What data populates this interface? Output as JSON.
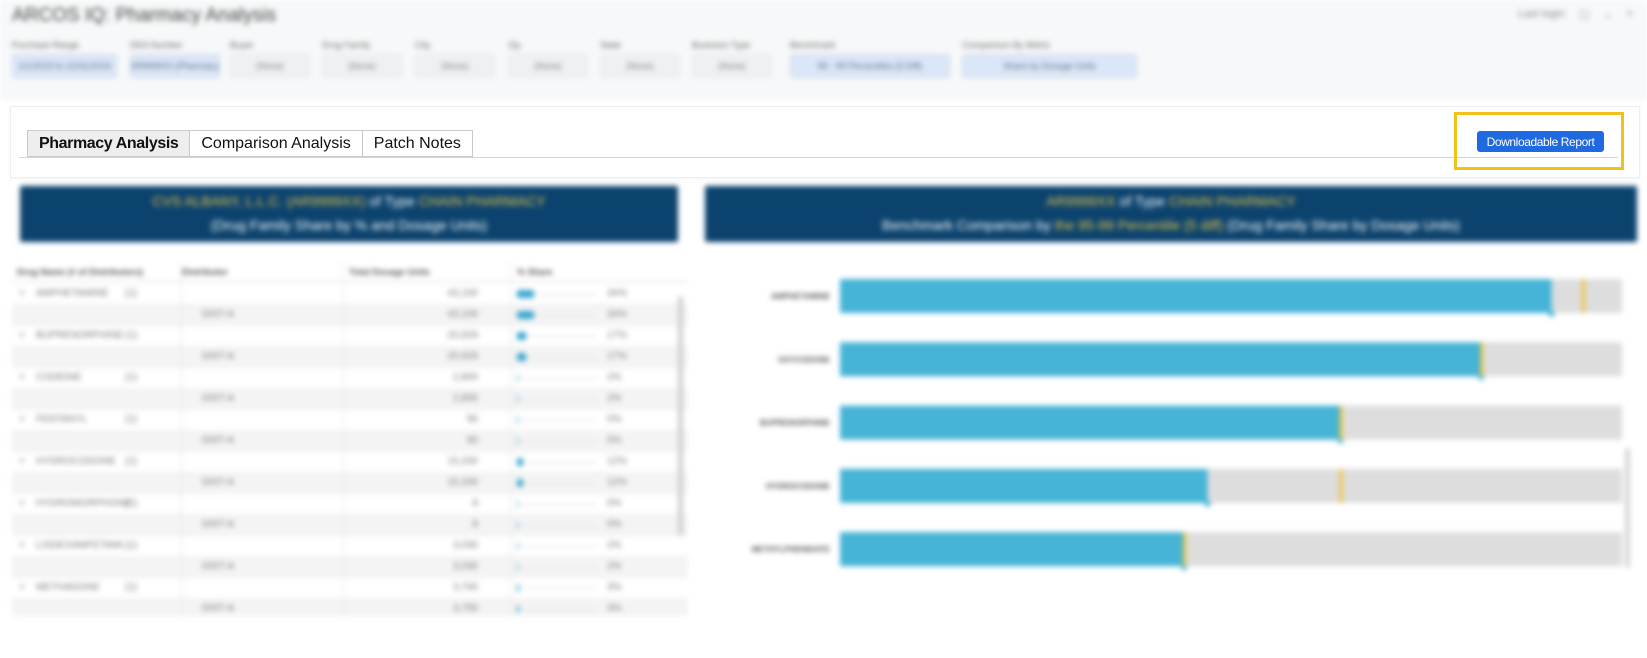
{
  "header": {
    "app_title": "ARCOS IQ: Pharmacy Analysis",
    "right_text": "Last login"
  },
  "filters": [
    {
      "label": "Purchase Range",
      "value": "1/1/2019 to 12/31/2019",
      "selected": true
    },
    {
      "label": "DEA Number",
      "value": "AR9999XX (Pharmacy)",
      "selected": true
    },
    {
      "label": "Buyer",
      "value": "(None)",
      "selected": false
    },
    {
      "label": "Drug Family",
      "value": "(None)",
      "selected": false
    },
    {
      "label": "City",
      "value": "(None)",
      "selected": false
    },
    {
      "label": "Zip",
      "value": "(None)",
      "selected": false
    },
    {
      "label": "State",
      "value": "(None)",
      "selected": false
    },
    {
      "label": "Business Type",
      "value": "(None)",
      "selected": false
    },
    {
      "label": "Benchmark",
      "value": "95 - 99 Percentiles (5 Diff)",
      "selected": true
    },
    {
      "label": "Comparison By Metric",
      "value": "Share by Dosage Units",
      "selected": true
    }
  ],
  "tabs": [
    {
      "label": "Pharmacy Analysis",
      "active": true
    },
    {
      "label": "Comparison Analysis",
      "active": false
    },
    {
      "label": "Patch Notes",
      "active": false
    }
  ],
  "download_button": "Downloadable Report",
  "left_panel": {
    "title_highlight": "CVS ALBANY, L.L.C. (AR9999XX)",
    "title_mid": " of Type ",
    "title_type": "CHAIN PHARMACY",
    "subtitle": "(Drug Family Share by % and Dosage Units)"
  },
  "right_panel": {
    "title_highlight": "AR9999XX",
    "title_mid": " of Type ",
    "title_type": "CHAIN PHARMACY",
    "sub_prefix": "Benchmark Comparison by ",
    "sub_highlight": "the 95-99 Percentile (5 diff)",
    "sub_suffix": " (Drug Family Share by Dosage Units)"
  },
  "table": {
    "columns": [
      "Drug Name (# of Distributors)",
      "Distributor",
      "Total Dosage Units",
      "% Share"
    ],
    "rows": [
      {
        "kind": "group",
        "name": "AMPHETAMINE",
        "count": "(1)",
        "units": "43,100",
        "pct": "34%",
        "share": 0.34
      },
      {
        "kind": "sub",
        "dist": "DIST-A",
        "units": "43,100",
        "pct": "34%",
        "share": 0.34
      },
      {
        "kind": "group",
        "name": "BUPRENORPHINE",
        "count": "(1)",
        "units": "20,929",
        "pct": "17%",
        "share": 0.17
      },
      {
        "kind": "sub",
        "dist": "DIST-A",
        "units": "20,929",
        "pct": "17%",
        "share": 0.17
      },
      {
        "kind": "group",
        "name": "CODEINE",
        "count": "(1)",
        "units": "2,800",
        "pct": "2%",
        "share": 0.02
      },
      {
        "kind": "sub",
        "dist": "DIST-A",
        "units": "2,800",
        "pct": "2%",
        "share": 0.02
      },
      {
        "kind": "group",
        "name": "FENTANYL",
        "count": "(1)",
        "units": "90",
        "pct": "0%",
        "share": 0.0
      },
      {
        "kind": "sub",
        "dist": "DIST-A",
        "units": "90",
        "pct": "0%",
        "share": 0.0
      },
      {
        "kind": "group",
        "name": "HYDROCODONE",
        "count": "(1)",
        "units": "15,200",
        "pct": "12%",
        "share": 0.12
      },
      {
        "kind": "sub",
        "dist": "DIST-A",
        "units": "15,200",
        "pct": "12%",
        "share": 0.12
      },
      {
        "kind": "group",
        "name": "HYDROMORPHONE",
        "count": "(1)",
        "units": "8",
        "pct": "0%",
        "share": 0.0
      },
      {
        "kind": "sub",
        "dist": "DIST-A",
        "units": "8",
        "pct": "0%",
        "share": 0.0
      },
      {
        "kind": "group",
        "name": "LISDEXAMFETAMI...",
        "count": "(1)",
        "units": "3,030",
        "pct": "2%",
        "share": 0.02
      },
      {
        "kind": "sub",
        "dist": "DIST-A",
        "units": "3,030",
        "pct": "2%",
        "share": 0.02
      },
      {
        "kind": "group",
        "name": "METHADONE",
        "count": "(1)",
        "units": "3,700",
        "pct": "3%",
        "share": 0.03
      },
      {
        "kind": "sub",
        "dist": "DIST-A",
        "units": "3,700",
        "pct": "3%",
        "share": 0.03
      }
    ]
  },
  "chart_data": {
    "type": "bar",
    "orientation": "horizontal",
    "categories": [
      "AMPHETAMINE",
      "OXYCODONE",
      "BUPRENORPHINE",
      "HYDROCODONE",
      "METHYLPHENIDATE"
    ],
    "series": [
      {
        "values": [
          0.91,
          0.82,
          0.64,
          0.47,
          0.44
        ]
      },
      {
        "values": [
          0.95,
          0.82,
          0.64,
          0.64,
          0.44
        ]
      }
    ],
    "xlim": [
      0,
      1
    ],
    "colors": {
      "bar": "#45b4d7",
      "track": "#dddddd",
      "benchmark": "#f0c330"
    }
  },
  "colors": {
    "panel_header": "#0c436e",
    "highlight_text": "#e8c64a",
    "button": "#1f6ae0",
    "callout": "#f2c21a"
  }
}
